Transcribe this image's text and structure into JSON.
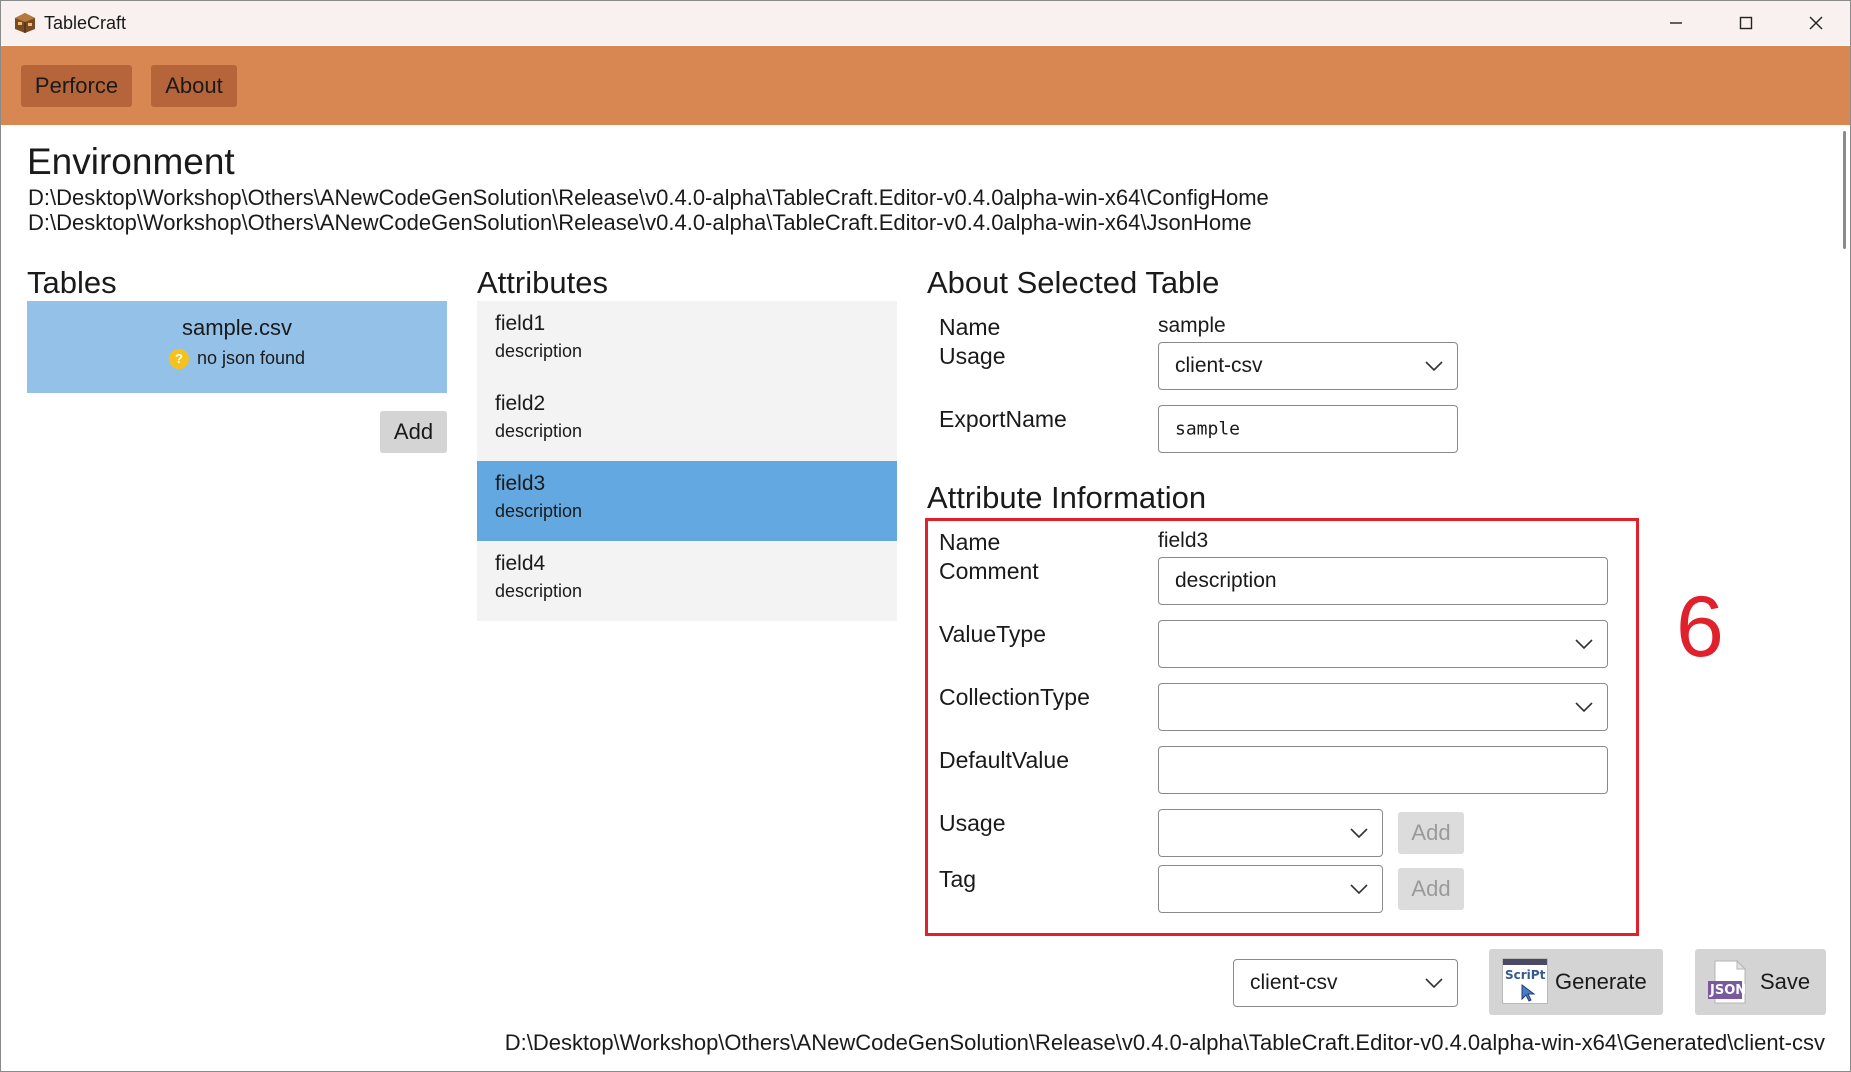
{
  "window": {
    "title": "TableCraft"
  },
  "menu": {
    "perforce": "Perforce",
    "about": "About"
  },
  "environment": {
    "heading": "Environment",
    "config_path": "D:\\Desktop\\Workshop\\Others\\ANewCodeGenSolution\\Release\\v0.4.0-alpha\\TableCraft.Editor-v0.4.0alpha-win-x64\\ConfigHome",
    "json_path": "D:\\Desktop\\Workshop\\Others\\ANewCodeGenSolution\\Release\\v0.4.0-alpha\\TableCraft.Editor-v0.4.0alpha-win-x64\\JsonHome"
  },
  "tables": {
    "heading": "Tables",
    "items": [
      {
        "name": "sample.csv",
        "status": "no json found",
        "status_icon": "question-icon"
      }
    ],
    "add_label": "Add"
  },
  "attributes": {
    "heading": "Attributes",
    "items": [
      {
        "name": "field1",
        "description": "description",
        "selected": false
      },
      {
        "name": "field2",
        "description": "description",
        "selected": false
      },
      {
        "name": "field3",
        "description": "description",
        "selected": true
      },
      {
        "name": "field4",
        "description": "description",
        "selected": false
      }
    ]
  },
  "selected_table": {
    "heading": "About Selected Table",
    "name_label": "Name",
    "name_value": "sample",
    "usage_label": "Usage",
    "usage_value": "client-csv",
    "export_label": "ExportName",
    "export_value": "sample"
  },
  "attribute_info": {
    "heading": "Attribute Information",
    "name_label": "Name",
    "name_value": "field3",
    "comment_label": "Comment",
    "comment_value": "description",
    "valuetype_label": "ValueType",
    "valuetype_value": "",
    "collectiontype_label": "CollectionType",
    "collectiontype_value": "",
    "defaultvalue_label": "DefaultValue",
    "defaultvalue_value": "",
    "usage_label": "Usage",
    "usage_value": "",
    "usage_add": "Add",
    "tag_label": "Tag",
    "tag_value": "",
    "tag_add": "Add"
  },
  "annotation": {
    "number": "6",
    "color": "#e0202a"
  },
  "footer": {
    "target_value": "client-csv",
    "generate_label": "Generate",
    "generate_icon_text": "ScriPt",
    "save_label": "Save",
    "save_icon_text": "JSON",
    "output_path": "D:\\Desktop\\Workshop\\Others\\ANewCodeGenSolution\\Release\\v0.4.0-alpha\\TableCraft.Editor-v0.4.0alpha-win-x64\\Generated\\client-csv"
  },
  "colors": {
    "header": "#d98752",
    "menu_button": "#b6653a",
    "table_selected": "#94c1e8",
    "attr_selected": "#63a8e1"
  }
}
